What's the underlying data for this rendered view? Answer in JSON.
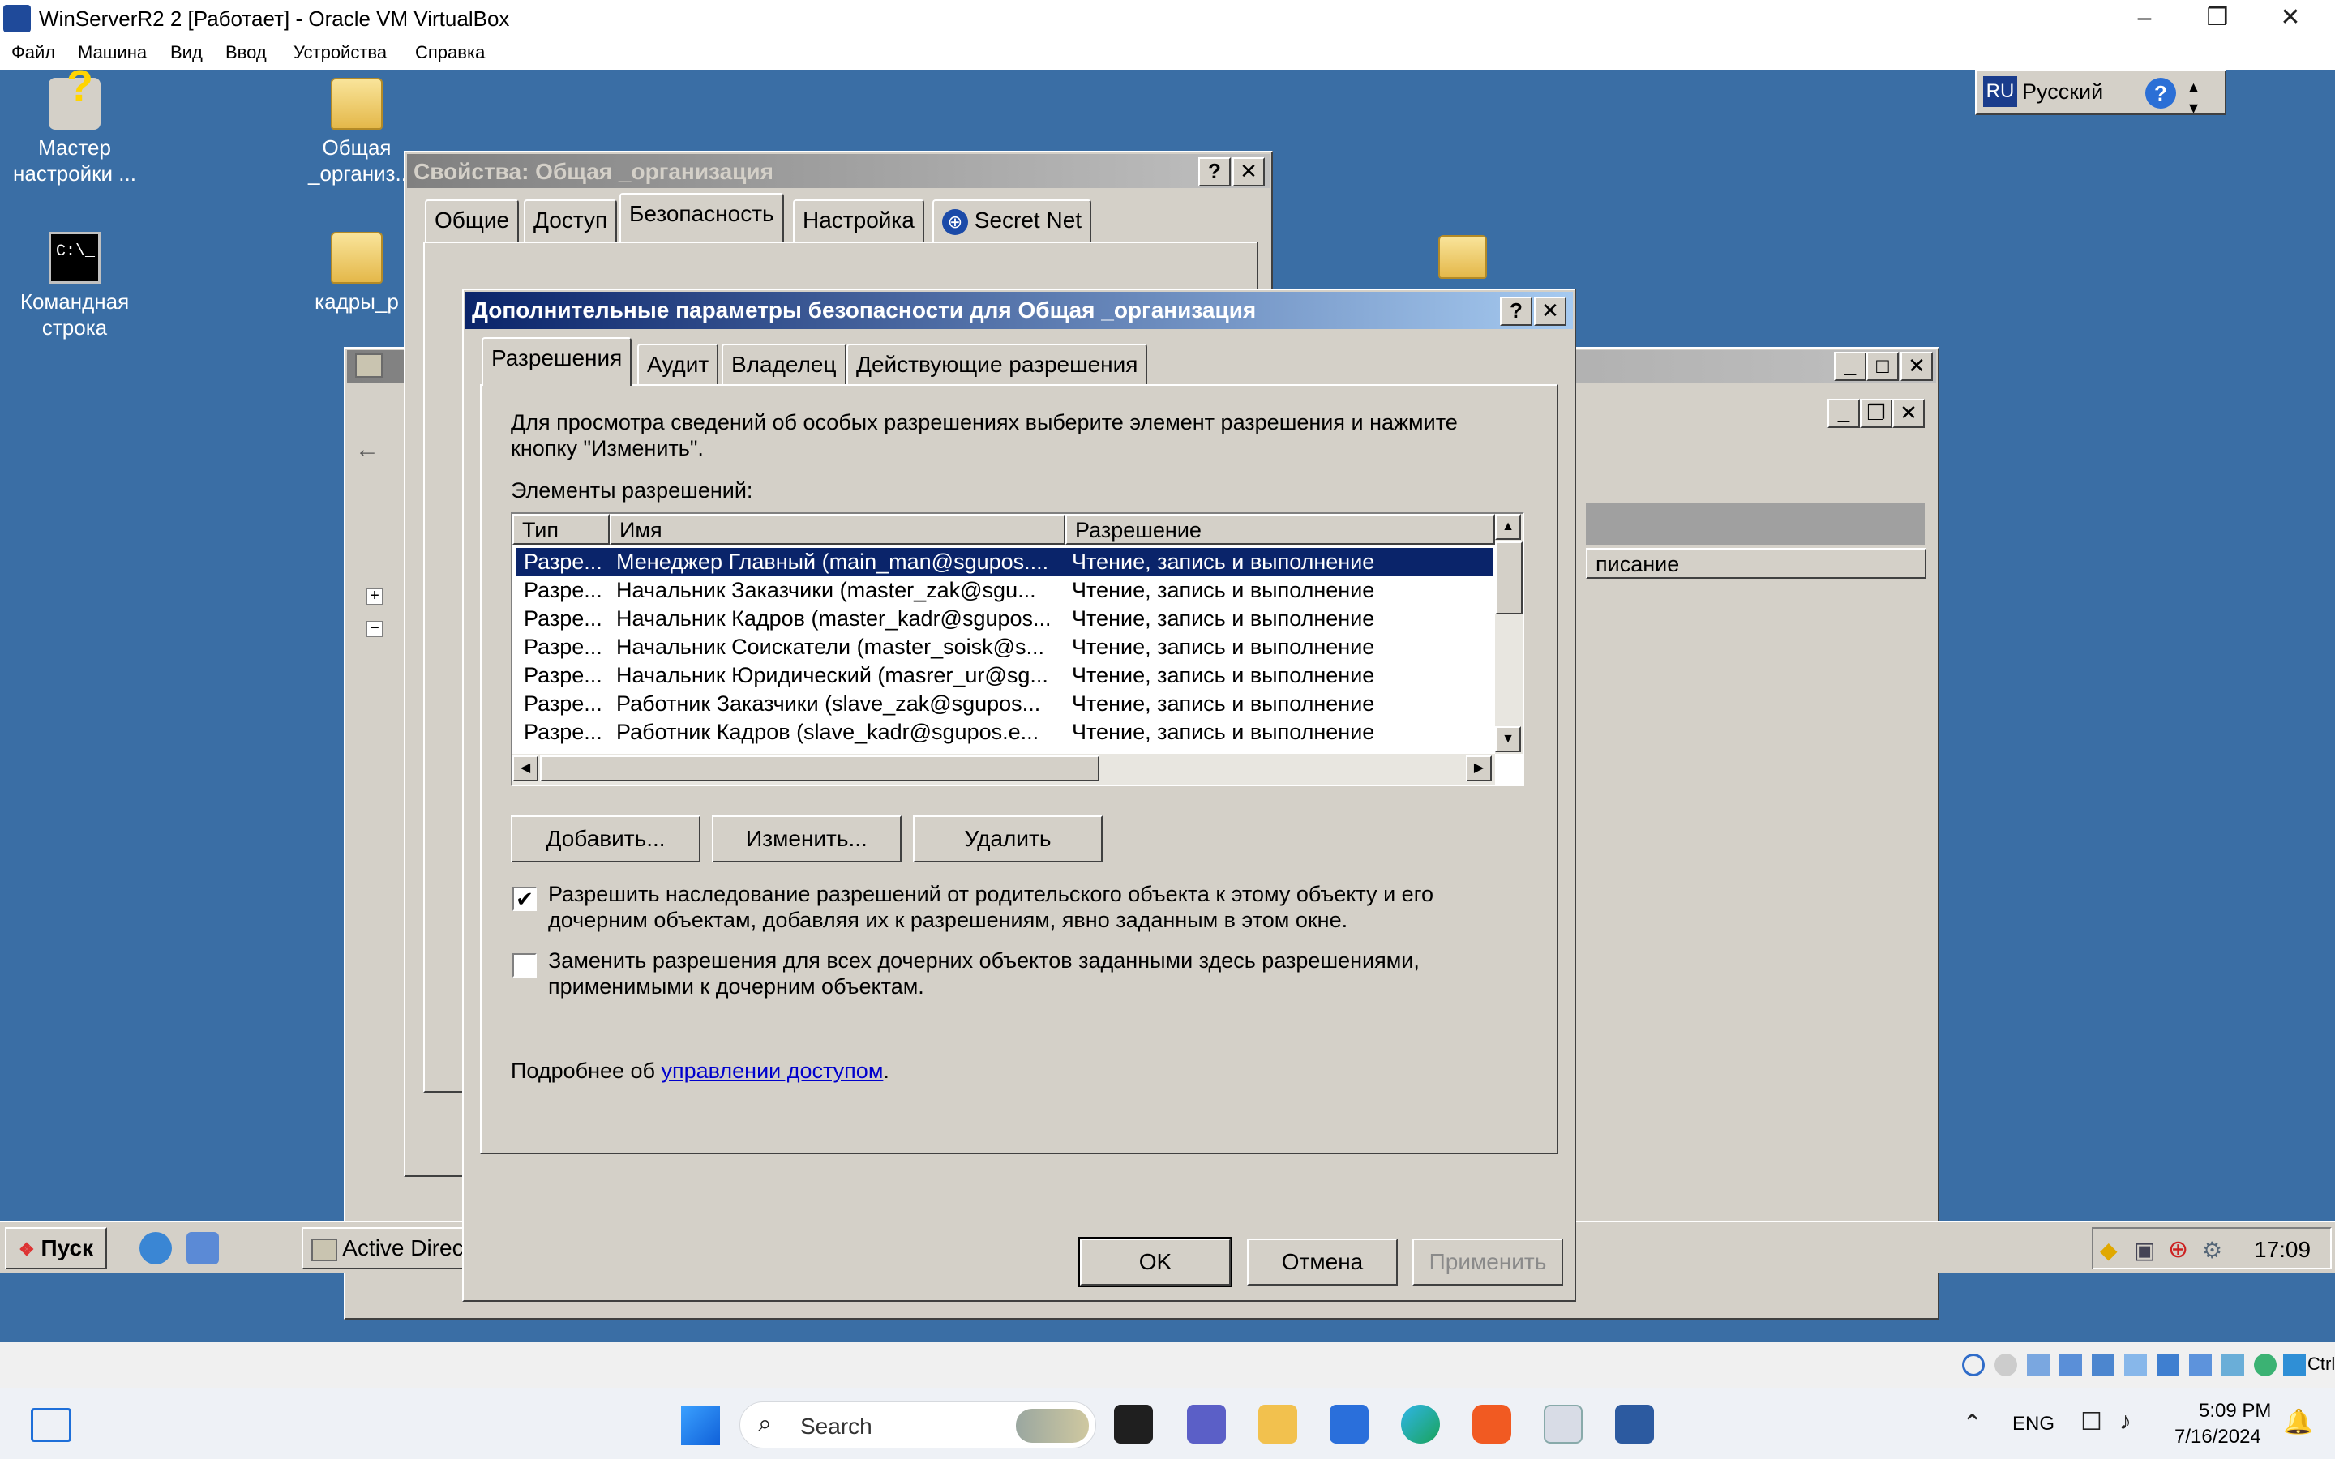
{
  "host": {
    "title": "WinServerR2 2 [Работает] - Oracle VM VirtualBox",
    "menu": [
      "Файл",
      "Машина",
      "Вид",
      "Ввод",
      "Устройства",
      "Справка"
    ]
  },
  "desktop": {
    "icons": [
      {
        "label_line1": "Мастер",
        "label_line2": "настройки ..."
      },
      {
        "label_line1": "Общая",
        "label_line2": "_организ..."
      },
      {
        "label_line1": "Командная",
        "label_line2": "строка"
      },
      {
        "label_line1": "кадры_р",
        "label_line2": ""
      }
    ],
    "language_bar": {
      "code": "RU",
      "label": "Русский"
    }
  },
  "properties_window": {
    "title": "Свойства: Общая _организация",
    "tabs": [
      "Общие",
      "Доступ",
      "Безопасность",
      "Настройка",
      "Secret Net"
    ]
  },
  "ad_window": {
    "title": "Active Directory - польз...",
    "column_description": "писание"
  },
  "dialog": {
    "title": "Дополнительные параметры безопасности для Общая _организация",
    "tabs": [
      "Разрешения",
      "Аудит",
      "Владелец",
      "Действующие разрешения"
    ],
    "description_line1": "Для просмотра сведений об особых разрешениях выберите элемент разрешения и нажмите",
    "description_line2": "кнопку \"Изменить\".",
    "list_label": "Элементы разрешений:",
    "columns": {
      "type": "Тип",
      "name": "Имя",
      "permission": "Разрешение"
    },
    "rows": [
      {
        "type": "Разре...",
        "name": "Менеджер Главный (main_man@sgupos....",
        "permission": "Чтение, запись и выполнение",
        "selected": true
      },
      {
        "type": "Разре...",
        "name": "Начальник Заказчики (master_zak@sgu...",
        "permission": "Чтение, запись и выполнение",
        "selected": false
      },
      {
        "type": "Разре...",
        "name": "Начальник Кадров (master_kadr@sgupos...",
        "permission": "Чтение, запись и выполнение",
        "selected": false
      },
      {
        "type": "Разре...",
        "name": "Начальник Соискатели (master_soisk@s...",
        "permission": "Чтение, запись и выполнение",
        "selected": false
      },
      {
        "type": "Разре...",
        "name": "Начальник Юридический (masrer_ur@sg...",
        "permission": "Чтение, запись и выполнение",
        "selected": false
      },
      {
        "type": "Разре...",
        "name": "Работник Заказчики (slave_zak@sgupos...",
        "permission": "Чтение, запись и выполнение",
        "selected": false
      },
      {
        "type": "Разре...",
        "name": "Работник Кадров (slave_kadr@sgupos.e...",
        "permission": "Чтение, запись и выполнение",
        "selected": false
      }
    ],
    "buttons": {
      "add": "Добавить...",
      "edit": "Изменить...",
      "remove": "Удалить"
    },
    "inherit_checkbox": {
      "checked": true,
      "line1": "Разрешить наследование разрешений от родительского объекта к этому объекту и его",
      "line2": "дочерним объектам, добавляя их к разрешениям, явно заданным в этом окне."
    },
    "replace_checkbox": {
      "checked": false,
      "line1": "Заменить разрешения для всех дочерних объектов заданными здесь разрешениями,",
      "line2": "применимыми к дочерним объектам."
    },
    "more_info_prefix": "Подробнее об ",
    "more_info_link": "управлении доступом",
    "more_info_suffix": ".",
    "ok": "OK",
    "cancel": "Отмена",
    "apply": "Применить"
  },
  "guest_taskbar": {
    "start": "Пуск",
    "task": "Active Directory - польз...",
    "clock": "17:09"
  },
  "vbox_status": {
    "host_key": "Ctrl"
  },
  "win11_taskbar": {
    "search_placeholder": "Search",
    "language": "ENG",
    "time": "5:09 PM",
    "date": "7/16/2024"
  }
}
